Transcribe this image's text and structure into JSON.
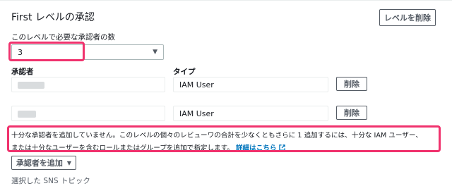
{
  "level": {
    "title": "First レベルの承認",
    "delete_label": "レベルを削除"
  },
  "approvers_count": {
    "label": "このレベルで必要な承認者の数",
    "value": "3"
  },
  "columns": {
    "approver": "承認者",
    "type": "タイプ"
  },
  "rows": [
    {
      "type": "IAM User",
      "delete_label": "削除"
    },
    {
      "type": "IAM User",
      "delete_label": "削除"
    }
  ],
  "warning": {
    "text": "十分な承認者を追加していません。このレベルの個々のレビューワの合計を少なくともさらに 1 追加するには、十分な IAM ユーザー、または十分なユーザーを含むロールまたはグループを追加で指定します。",
    "link": "詳細はこちら"
  },
  "add_approver": {
    "label": "承認者を追加"
  },
  "sns": {
    "label": "選択した SNS トピック"
  },
  "colors": {
    "highlight": "#f0326d",
    "link": "#0073bb"
  }
}
